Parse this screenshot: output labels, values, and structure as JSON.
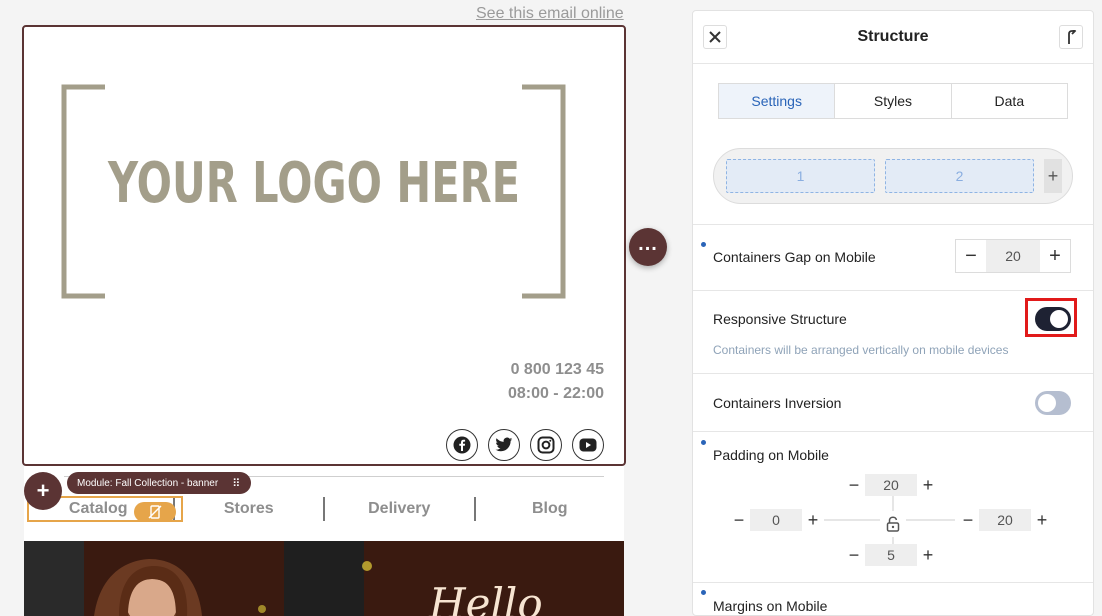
{
  "email": {
    "view_online": "See this email online",
    "logo_text": "YOUR LOGO HERE",
    "phone": "0 800 123 45",
    "hours": "08:00 - 22:00",
    "social": [
      "facebook-icon",
      "twitter-icon",
      "instagram-icon",
      "youtube-icon"
    ],
    "module_tag": "Module: Fall Collection - banner",
    "menu": [
      "Catalog",
      "Stores",
      "Delivery",
      "Blog"
    ],
    "hero_text": "Hello"
  },
  "panel": {
    "title": "Structure",
    "tabs": [
      {
        "label": "Settings",
        "active": true
      },
      {
        "label": "Styles",
        "active": false
      },
      {
        "label": "Data",
        "active": false
      }
    ],
    "containers": [
      "1",
      "2"
    ],
    "gap": {
      "label": "Containers Gap on Mobile",
      "value": "20"
    },
    "responsive": {
      "label": "Responsive Structure",
      "hint": "Containers will be arranged vertically on mobile devices",
      "enabled": true
    },
    "inversion": {
      "label": "Containers Inversion",
      "enabled": false
    },
    "padding": {
      "label": "Padding on Mobile",
      "top": "20",
      "left": "0",
      "right": "20",
      "bottom": "5"
    },
    "margins": {
      "label": "Margins on Mobile"
    }
  },
  "colors": {
    "brand": "#5b3434",
    "accent_blue": "#2a64b8",
    "highlight": "#e11a1a",
    "selection_orange": "#e6a54a"
  }
}
